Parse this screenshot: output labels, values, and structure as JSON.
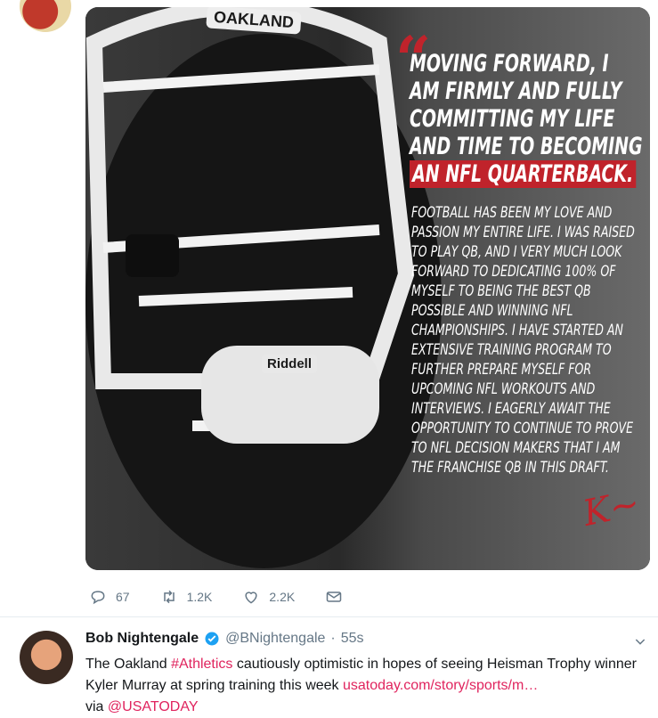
{
  "image_card": {
    "helmet_label": "OAKLAND",
    "helmet_brand": "Riddell",
    "headline_lines": [
      "MOVING FORWARD, I",
      "AM FIRMLY AND FULLY",
      "COMMITTING MY LIFE",
      "AND TIME TO BECOMING"
    ],
    "headline_highlight": "AN NFL QUARTERBACK.",
    "body": "FOOTBALL HAS BEEN MY LOVE AND PASSION MY ENTIRE LIFE. I WAS RAISED TO PLAY QB, AND I VERY MUCH LOOK FORWARD TO DEDICATING 100% OF MYSELF TO BEING THE BEST QB POSSIBLE AND WINNING NFL CHAMPIONSHIPS. I HAVE STARTED AN EXTENSIVE TRAINING PROGRAM TO FURTHER PREPARE MYSELF FOR UPCOMING NFL WORKOUTS AND INTERVIEWS. I EAGERLY AWAIT THE OPPORTUNITY TO CONTINUE TO PROVE TO NFL DECISION MAKERS THAT I AM THE FRANCHISE QB IN THIS DRAFT.",
    "accent_color": "#c0232b"
  },
  "actions": {
    "replies": "67",
    "retweets": "1.2K",
    "likes": "2.2K"
  },
  "tweet": {
    "name": "Bob Nightengale",
    "handle": "@BNightengale",
    "time": "55s",
    "text_before": "The Oakland ",
    "hashtag": "#Athletics",
    "text_after": " cautiously optimistic in hopes of seeing Heisman Trophy winner Kyler Murray at spring training this week ",
    "link": "usatoday.com/story/sports/m…",
    "via_prefix": "via ",
    "via": "@USATODAY",
    "link_color": "#e0245e"
  }
}
